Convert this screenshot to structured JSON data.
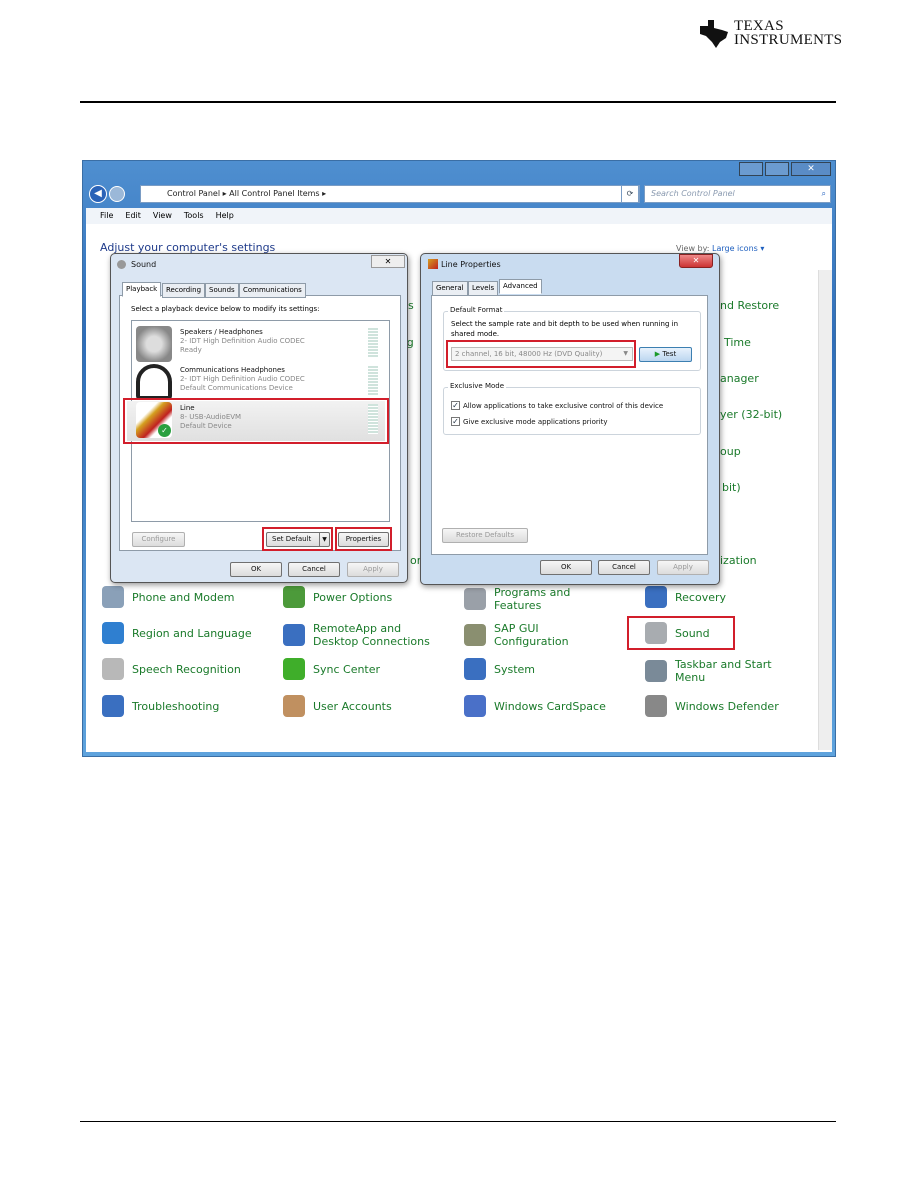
{
  "brand": {
    "logo_text_line1": "Texas",
    "logo_text_line2": "Instruments"
  },
  "explorer": {
    "breadcrumb": [
      "Control Panel",
      "All Control Panel Items"
    ],
    "search_placeholder": "Search Control Panel",
    "menu": [
      "File",
      "Edit",
      "View",
      "Tools",
      "Help"
    ],
    "heading": "Adjust your computer's settings",
    "view_by_label": "View by:",
    "view_by_value": "Large icons",
    "partial_items": [
      "s",
      "ag",
      "or",
      "nd Restore",
      "Time",
      "anager",
      "yer (32-bit)",
      "oup",
      "bit)",
      "ization"
    ],
    "items": [
      {
        "label": "Phone and Modem",
        "icon": "phone-modem-icon",
        "color": "#8aa0b8"
      },
      {
        "label": "Power Options",
        "icon": "power-options-icon",
        "color": "#4c9a3a"
      },
      {
        "label": "Programs and Features",
        "icon": "programs-features-icon",
        "color": "#9aa0a8"
      },
      {
        "label": "Recovery",
        "icon": "recovery-icon",
        "color": "#3a6fc0"
      },
      {
        "label": "Region and Language",
        "icon": "region-language-icon",
        "color": "#2f7fd0"
      },
      {
        "label": "RemoteApp and Desktop Connections",
        "icon": "remoteapp-icon",
        "color": "#3a6fc0"
      },
      {
        "label": "SAP GUI Configuration",
        "icon": "sap-gui-icon",
        "color": "#8a8f70"
      },
      {
        "label": "Sound",
        "icon": "speaker-icon",
        "color": "#a8acb0",
        "highlighted": true
      },
      {
        "label": "Speech Recognition",
        "icon": "microphone-icon",
        "color": "#b8b8b8"
      },
      {
        "label": "Sync Center",
        "icon": "sync-center-icon",
        "color": "#3fae2a"
      },
      {
        "label": "System",
        "icon": "system-icon",
        "color": "#3a6fc0"
      },
      {
        "label": "Taskbar and Start Menu",
        "icon": "taskbar-icon",
        "color": "#7a8a98"
      },
      {
        "label": "Troubleshooting",
        "icon": "troubleshooting-icon",
        "color": "#3a6fc0"
      },
      {
        "label": "User Accounts",
        "icon": "user-accounts-icon",
        "color": "#c09060"
      },
      {
        "label": "Windows CardSpace",
        "icon": "cardspace-icon",
        "color": "#4a70c8"
      },
      {
        "label": "Windows Defender",
        "icon": "windows-defender-icon",
        "color": "#888"
      }
    ]
  },
  "sound_dialog": {
    "title": "Sound",
    "tabs": [
      "Playback",
      "Recording",
      "Sounds",
      "Communications"
    ],
    "instruction": "Select a playback device below to modify its settings:",
    "devices": [
      {
        "name": "Speakers / Headphones",
        "driver": "2- IDT High Definition Audio CODEC",
        "status": "Ready"
      },
      {
        "name": "Communications Headphones",
        "driver": "2- IDT High Definition Audio CODEC",
        "status": "Default Communications Device"
      },
      {
        "name": "Line",
        "driver": "8- USB-AudioEVM",
        "status": "Default Device",
        "selected": true
      }
    ],
    "configure": "Configure",
    "set_default": "Set Default",
    "properties": "Properties",
    "ok": "OK",
    "cancel": "Cancel",
    "apply": "Apply"
  },
  "line_dialog": {
    "title": "Line Properties",
    "tabs": [
      "General",
      "Levels",
      "Advanced"
    ],
    "default_format_label": "Default Format",
    "format_instruction": "Select the sample rate and bit depth to be used when running in shared mode.",
    "format_value": "2 channel, 16 bit, 48000 Hz (DVD Quality)",
    "test": "Test",
    "exclusive_label": "Exclusive Mode",
    "check1": "Allow applications to take exclusive control of this device",
    "check2": "Give exclusive mode applications priority",
    "restore": "Restore Defaults",
    "ok": "OK",
    "cancel": "Cancel",
    "apply": "Apply"
  },
  "colors": {
    "highlight": "#d21e2b",
    "link_green": "#1a7a2a",
    "title_blue": "#1e3a8a"
  }
}
